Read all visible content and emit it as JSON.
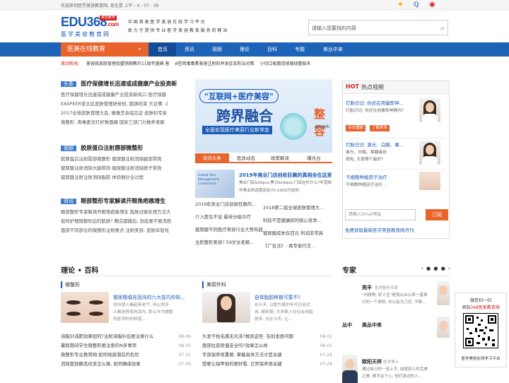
{
  "topbar": {
    "welcome": "欢迎来到医学美容教育网, 现在是 上午 : 4 : 07 : 39",
    "icons": [
      "star-icon",
      "qq-icon",
      "weibo-icon"
    ]
  },
  "logo": {
    "main": "EDU368",
    "dot": ".com",
    "badge": "美容教育",
    "sub": "医学美容教育网"
  },
  "slogan": {
    "line1": "中 国 首 家 医 学 美 容 在 线 学 习 平 台",
    "line2": "致 力 于 提 供 专 业 医 学 美 容 教 育 服 务 的 网 站"
  },
  "search": {
    "placeholder": "请输入您要找的内容"
  },
  "nav": {
    "brand": "医美在线教育",
    "items": [
      "首页",
      "资讯",
      "视频",
      "理论",
      "百科",
      "专题",
      "美丛中来"
    ]
  },
  "ticker": {
    "label": "滚动新闻:",
    "items": [
      "美容我皮肤管理加盟铁腕教尔11周年盛典 营",
      "A型肉毒毒素美容注射的并发症及防治对策",
      "小切口吸脂连续搜线整赔术"
    ]
  },
  "section_news": {
    "tag": "头条",
    "title": "医疗保健增长迅速或成健康产业投资新",
    "lines": [
      "医疗保健增长迅速或成健康产业投资新风口  医疗保健",
      "EASPEER亚太区皮肤管理研修班, 圆满结束  大证事: 2",
      "2017全球皮肤管理大会, 敢雅芝亲临见证  皮肤科专家",
      "微整形: 肉毒素没打好致面瘫  国家三部门力推养老服"
    ]
  },
  "section_video": {
    "tag": "视频",
    "title": "胶原蛋白注射唇部微整形",
    "lines": [
      "胶原蛋白注射唇部微整形  玻尿酸注射消除腿部赘肉",
      "玻尿酸注射消除大腿赘肉  玻尿酸注射消除脖子赘肉",
      "玻尿酸注射注射消除脂肪  体验微针全过程"
    ]
  },
  "section_info": {
    "tag": "资讯",
    "title": "眼部整形专家解读开眼角疤痕增生",
    "lines": [
      "眼部整形专家解读开眼角疤痕增生  肌肤过敏处理方法大",
      "如何护理微整形后的肌肤?  敷完面膜后, 到底要不要洗脸",
      "面部不同部位的微整形注射要点  注射美容: 皮肤年轻化"
    ]
  },
  "banner": {
    "pill": "\"互联网+医疗美容\"",
    "big": "跨界融合",
    "strip": "全面实现医疗美容行业新常态",
    "right": "整容",
    "right_sub": "模拟画布"
  },
  "tabs2": [
    "资讯头条",
    "医改动态",
    "政策解读",
    "曝光台"
  ],
  "news_feature": {
    "thumb_text": "Global Skin Management Conference",
    "title": "2019年美业门店创收狂飙的真相全在这里",
    "desc": "美业门店&ldquo;黑马&rdquo;门店在忙什么?年营收年美业的连锁店在70-1000万初创"
  },
  "news_list": [
    [
      "2019年美业门店创收狂飙的...",
      "2018第二届全球皮肤管理大..."
    ],
    [
      "介入医生不足 最待分级诊疗",
      "科技不是健康校的核心竞争..."
    ],
    [
      "玻尿酸不同医疗美容行业大势所趋",
      "玻尿酸成本仅百元 利润非常高"
    ],
    [
      "全脸整形美容? 59岁女老赖...",
      "《广告法》: 真专家代言..."
    ]
  ],
  "hot": {
    "h1": "HOT",
    "h2": "热点视频",
    "items": [
      {
        "title": "灯胎日记: 你还在用量即神...",
        "desc": "灯胎日记: 你还在用量即神器吗?",
        "btn1": "点击播放",
        "btn2": "了解更多"
      },
      {
        "title": "灯胎日记: 激光、白醋、果...",
        "desc1": "激光、白醋、果酸痛祛",
        "desc2": "斑啦, 灭斑哪个最好?"
      },
      {
        "title": "干细胞种植因子治疗",
        "desc": "干细胞种植因子治疗..."
      }
    ]
  },
  "subscribe": {
    "placeholder": "请输入Email地址",
    "button": "订阅",
    "note": "免费获取最新医学美容教育网月刊"
  },
  "theory": {
    "title": "理论 • 百科",
    "left": {
      "label": "微整形",
      "feature_title": "玻尿酸填充泪沟的六大技巧你知...",
      "feature_desc": [
        "泪沟使人看起来老气, 所以很多",
        "人都选择填充泪沟, 那么作为微整",
        "形医师的你知道..."
      ],
      "rows": [
        [
          "溶脂针减肥效果如何?注射溶脂针后要注意什么",
          "08-06"
        ],
        [
          "暑假期间学生微整形要注意的N多事项",
          "08-05"
        ],
        [
          "微整形专业教育网:如何规避潜在的危险",
          "07-31"
        ],
        [
          "消除面部静态纹该怎么做, 如何确保效果",
          "07-29"
        ]
      ]
    },
    "right": {
      "label": "美容外科",
      "feature_title": "自体脂肪移植可靠不?",
      "feature_desc": [
        "在今天, 以肥为美的年代已经过",
        "去, 瘦即美, 大多数人往往会说脂",
        "肪多, 也在今天, 让..."
      ],
      "rows": [
        [
          "头发干枯毛躁无光泽?做到这些, 告别发质问题",
          "08-02"
        ],
        [
          "面部拉皮除皱安全吗?效果怎么样",
          "08-01"
        ],
        [
          "手部保养很重要, 掌握具体方法才是关键",
          "07-29"
        ],
        [
          "想要让指甲很的更好看, 日常保养很关键",
          "07-28"
        ]
      ]
    }
  },
  "experts": {
    "title": "专家",
    "pager": "‹ ● ● ● ›",
    "list": [
      {
        "name": "苑丰",
        "role": "医师整形专家",
        "desc": [
          "\"问题啊, 好人生\"是我从业以来一直奉",
          "行的一个原则, 并以此为己任, 不断..."
        ]
      },
      {
        "name": "美丛中来",
        "role": "",
        "desc": []
      },
      {
        "name": "欧阳天祥",
        "role": "医学博士",
        "desc": [
          "通过自己的一双上手, 成就别人的完美",
          "之美, 美不足于人, 他们身边的人..."
        ]
      }
    ],
    "left_stub": "丛中"
  },
  "qr": {
    "line1": "微信扫一扫",
    "line2_prefix": "添加",
    "line2_brand": "368医美教育网",
    "line3": "医学美容在线学习平台"
  }
}
